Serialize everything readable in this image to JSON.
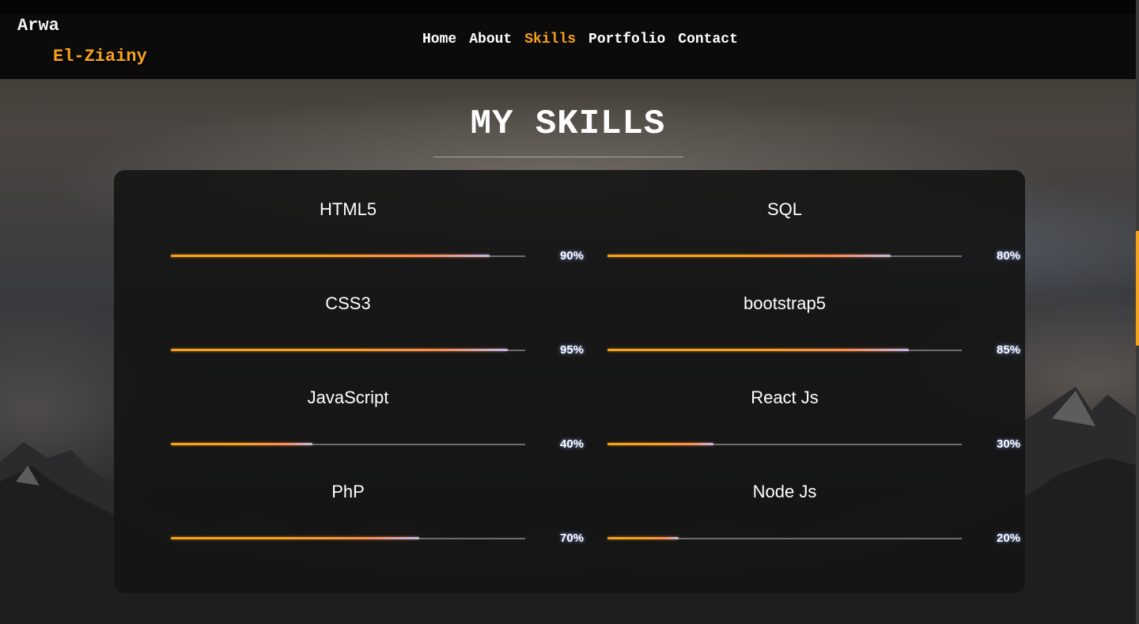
{
  "brand": {
    "first_name": "Arwa",
    "last_name": "El-Ziainy"
  },
  "nav": {
    "items": [
      {
        "label": "Home",
        "active": false
      },
      {
        "label": "About",
        "active": false
      },
      {
        "label": "Skills",
        "active": true
      },
      {
        "label": "Portfolio",
        "active": false
      },
      {
        "label": "Contact",
        "active": false
      }
    ]
  },
  "section": {
    "title": "MY SKILLS"
  },
  "skills": [
    {
      "name": "HTML5",
      "percent_label": "90%",
      "level": 0.9
    },
    {
      "name": "SQL",
      "percent_label": "80%",
      "level": 0.8
    },
    {
      "name": "CSS3",
      "percent_label": "95%",
      "level": 0.95
    },
    {
      "name": "bootstrap5",
      "percent_label": "85%",
      "level": 0.85
    },
    {
      "name": "JavaScript",
      "percent_label": "40%",
      "level": 0.4
    },
    {
      "name": "React Js",
      "percent_label": "30%",
      "level": 0.3
    },
    {
      "name": "PhP",
      "percent_label": "70%",
      "level": 0.7
    },
    {
      "name": "Node Js",
      "percent_label": "20%",
      "level": 0.2
    }
  ],
  "colors": {
    "accent": "#f7a21b",
    "text": "#ffffff",
    "panel": "#141414"
  }
}
